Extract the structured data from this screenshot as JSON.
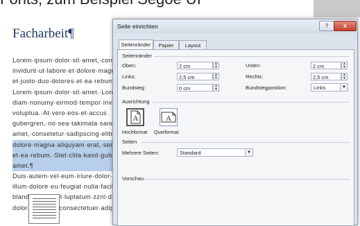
{
  "background_doc": {
    "top_caption": "Fonts, zum Beispiel Segoe UI",
    "title": "Facharbeit¶",
    "lines": [
      {
        "text": "Lorem·ipsum·dolor·sit·amet,·con",
        "highlighted": false
      },
      {
        "text": "invidunt·ut·labore·et·dolore·magna",
        "highlighted": false
      },
      {
        "text": "et·justo·duo·dolores·et·ea·rebum",
        "highlighted": false
      },
      {
        "text": "Lorem·ipsum·dolor·sit·amet.·Lore",
        "highlighted": false
      },
      {
        "text": "diam·nonumy·eirmod·tempor·invi",
        "highlighted": false
      },
      {
        "text": "voluptua.·At·vero·eos·et·accus",
        "highlighted": false
      },
      {
        "text": "gubergren,·no·sea·takimata·sanct",
        "highlighted": false
      },
      {
        "text": "amet,·consetetur·sadipscing·elitr,",
        "highlighted": false
      },
      {
        "text": "dolore·magna·aliquyam·erat,·sed·d",
        "highlighted": true
      },
      {
        "text": "et·ea·rebum.·Stet·clita·kasd·gube",
        "highlighted": true
      },
      {
        "text": "amet.¶",
        "highlighted": true
      },
      {
        "text": "Duis·autem·vel·eum·iriure·dolor·in",
        "highlighted": false
      },
      {
        "text": "illum·dolore·eu·feugiat·nulla·facili",
        "highlighted": false
      },
      {
        "text": "blandit·praesent·luptatum·zzril·dele",
        "highlighted": false
      },
      {
        "text": "dolor·sit·amet,·consectetuer·adipi",
        "highlighted": false
      }
    ]
  },
  "dialog": {
    "title": "Seite einrichten",
    "help_label": "?",
    "close_label": "x",
    "tabs": [
      {
        "label": "Seitenränder",
        "active": true
      },
      {
        "label": "Papier",
        "active": false
      },
      {
        "label": "Layout",
        "active": false
      }
    ],
    "margins": {
      "section_title": "Seitenränder",
      "top_label": "Oben:",
      "top_value": "2 cm",
      "bottom_label": "Unten:",
      "bottom_value": "2 cm",
      "left_label": "Links:",
      "left_value": "2,5 cm",
      "right_label": "Rechts:",
      "right_value": "2,5 cm",
      "gutter_label": "Bundsteg:",
      "gutter_value": "0 cm",
      "gutter_pos_label": "Bundstegposition:",
      "gutter_pos_value": "Links"
    },
    "orientation": {
      "section_title": "Ausrichtung",
      "portrait_label": "Hochformat",
      "landscape_label": "Querformat",
      "portrait_glyph": "A",
      "landscape_glyph": "A",
      "selected": "Hochformat"
    },
    "pages": {
      "section_title": "Seiten",
      "multiple_label": "Mehrere Seiten:",
      "multiple_value": "Standard"
    },
    "preview": {
      "section_title": "Vorschau"
    }
  }
}
